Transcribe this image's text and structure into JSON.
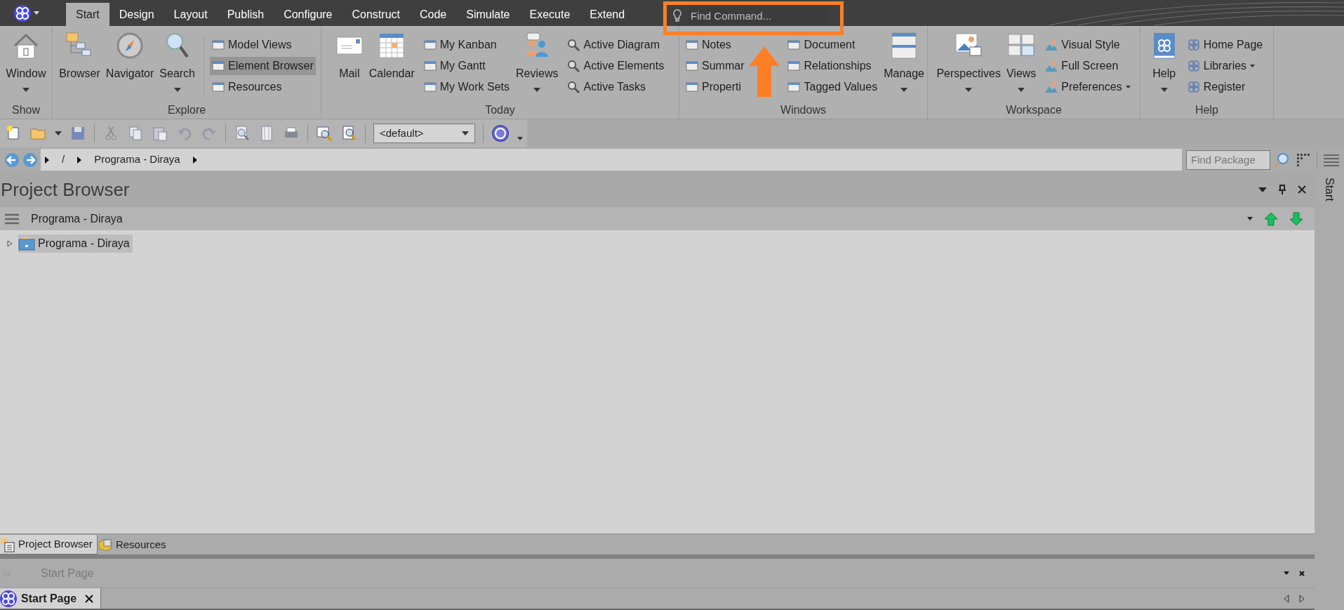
{
  "menu_tabs": [
    {
      "label": "Start",
      "selected": true
    },
    {
      "label": "Design",
      "selected": false
    },
    {
      "label": "Layout",
      "selected": false
    },
    {
      "label": "Publish",
      "selected": false
    },
    {
      "label": "Configure",
      "selected": false
    },
    {
      "label": "Construct",
      "selected": false
    },
    {
      "label": "Code",
      "selected": false
    },
    {
      "label": "Simulate",
      "selected": false
    },
    {
      "label": "Execute",
      "selected": false
    },
    {
      "label": "Extend",
      "selected": false
    }
  ],
  "find_command": {
    "placeholder": "Find Command..."
  },
  "ribbon": {
    "groups": [
      {
        "label": "Show",
        "items": [
          {
            "kind": "large",
            "label": "Window",
            "dropdown": true
          }
        ]
      },
      {
        "label": "Explore",
        "items": [
          {
            "kind": "large",
            "label": "Browser",
            "dropdown": false
          },
          {
            "kind": "large",
            "label": "Navigator",
            "dropdown": false
          },
          {
            "kind": "large",
            "label": "Search",
            "dropdown": true
          },
          {
            "kind": "list",
            "entries": [
              {
                "label": "Model Views",
                "selected": false,
                "dropdown": false
              },
              {
                "label": "Element Browser",
                "selected": true,
                "dropdown": false
              },
              {
                "label": "Resources",
                "selected": false,
                "dropdown": false
              }
            ]
          }
        ]
      },
      {
        "label": "Today",
        "items": [
          {
            "kind": "large",
            "label": "Mail",
            "dropdown": false
          },
          {
            "kind": "large",
            "label": "Calendar",
            "dropdown": false
          },
          {
            "kind": "list",
            "entries": [
              {
                "label": "My Kanban",
                "selected": false,
                "dropdown": false
              },
              {
                "label": "My Gantt",
                "selected": false,
                "dropdown": false
              },
              {
                "label": "My Work Sets",
                "selected": false,
                "dropdown": false
              }
            ]
          },
          {
            "kind": "large",
            "label": "Reviews",
            "dropdown": true
          },
          {
            "kind": "list",
            "entries": [
              {
                "label": "Active Diagram",
                "selected": false,
                "dropdown": false
              },
              {
                "label": "Active Elements",
                "selected": false,
                "dropdown": false
              },
              {
                "label": "Active Tasks",
                "selected": false,
                "dropdown": false
              }
            ]
          }
        ]
      },
      {
        "label": "Windows",
        "items": [
          {
            "kind": "list",
            "entries": [
              {
                "label": "Notes",
                "selected": false,
                "dropdown": false
              },
              {
                "label": "Summar",
                "selected": false,
                "dropdown": false
              },
              {
                "label": "Properti",
                "selected": false,
                "dropdown": false
              }
            ]
          },
          {
            "kind": "list",
            "entries": [
              {
                "label": "Document",
                "selected": false,
                "dropdown": false
              },
              {
                "label": "Relationships",
                "selected": false,
                "dropdown": false
              },
              {
                "label": "Tagged Values",
                "selected": false,
                "dropdown": false
              }
            ]
          },
          {
            "kind": "large",
            "label": "Manage",
            "dropdown": true
          }
        ]
      },
      {
        "label": "Workspace",
        "items": [
          {
            "kind": "large",
            "label": "Perspectives",
            "dropdown": true
          },
          {
            "kind": "large",
            "label": "Views",
            "dropdown": true
          },
          {
            "kind": "list",
            "entries": [
              {
                "label": "Visual Style",
                "selected": false,
                "dropdown": false
              },
              {
                "label": "Full Screen",
                "selected": false,
                "dropdown": false
              },
              {
                "label": "Preferences",
                "selected": false,
                "dropdown": true
              }
            ]
          }
        ]
      },
      {
        "label": "Help",
        "items": [
          {
            "kind": "large",
            "label": "Help",
            "dropdown": true
          },
          {
            "kind": "list",
            "entries": [
              {
                "label": "Home Page",
                "selected": false,
                "dropdown": false
              },
              {
                "label": "Libraries",
                "selected": false,
                "dropdown": true
              },
              {
                "label": "Register",
                "selected": false,
                "dropdown": false
              }
            ]
          }
        ]
      }
    ]
  },
  "toolbar": {
    "perspective_combo": "<default>"
  },
  "breadcrumb": {
    "items": [
      "/",
      "Programa - Diraya"
    ],
    "find_package": {
      "placeholder": "Find Package"
    }
  },
  "project_browser": {
    "title": "Project Browser",
    "package": "Programa - Diraya",
    "tree": [
      {
        "label": "Programa - Diraya",
        "expanded": false,
        "selected": true
      }
    ]
  },
  "bottom_tabs": [
    {
      "label": "Project Browser",
      "selected": true
    },
    {
      "label": "Resources",
      "selected": false
    }
  ],
  "start_page_bar": {
    "title": "Start Page"
  },
  "document_tabs": [
    {
      "label": "Start Page",
      "selected": true
    }
  ],
  "side_strip": {
    "label": "Start"
  }
}
